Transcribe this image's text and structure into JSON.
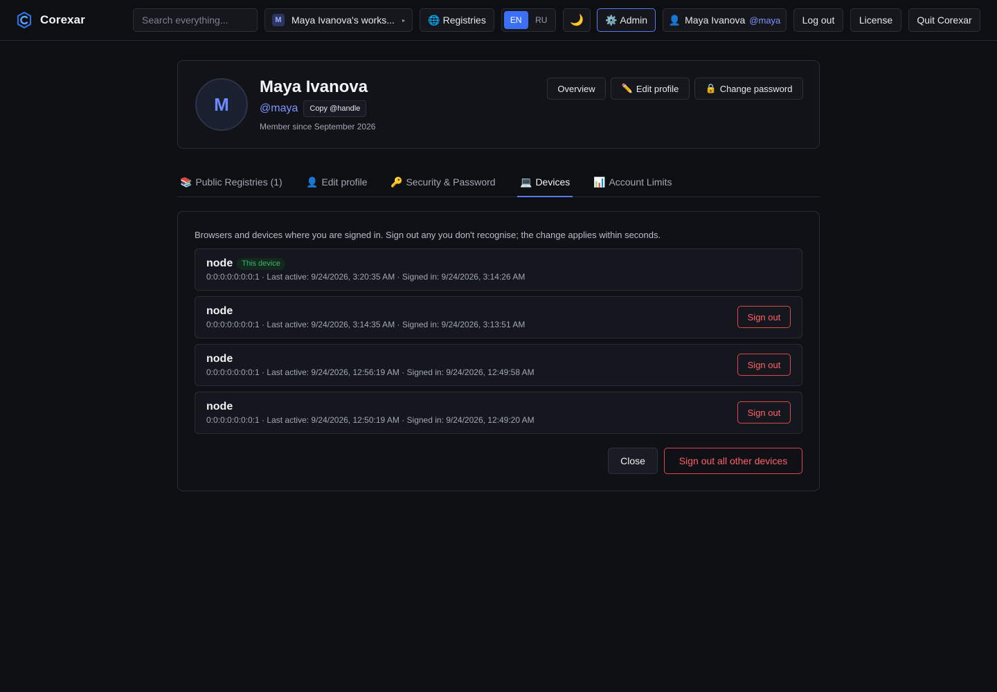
{
  "app": {
    "name": "Corexar",
    "brand_color": "#3b8cf5"
  },
  "topbar": {
    "search_placeholder": "Search everything...",
    "workspace": {
      "badge": "M",
      "label": "Maya Ivanova's works...",
      "caret": "▸"
    },
    "registries_icon": "🌐",
    "registries_label": "Registries",
    "languages": [
      {
        "code": "EN",
        "active": true
      },
      {
        "code": "RU",
        "active": false
      }
    ],
    "theme_icon": "🌙",
    "admin_icon": "⚙️",
    "admin_label": "Admin",
    "user_icon": "👤",
    "user_name": "Maya Ivanova",
    "user_handle": "@maya",
    "logout_label": "Log out",
    "license_label": "License",
    "quit_label": "Quit Corexar"
  },
  "profile": {
    "avatar_letter": "M",
    "name": "Maya Ivanova",
    "handle": "@maya",
    "copy_label": "Copy @handle",
    "member_since": "Member since September 2026",
    "actions": {
      "overview": "Overview",
      "edit_icon": "✏️",
      "edit": "Edit profile",
      "password_icon": "🔒",
      "password": "Change password"
    }
  },
  "tabs": [
    {
      "icon": "📚",
      "label": "Public Registries (1)",
      "active": false
    },
    {
      "icon": "👤",
      "label": "Edit profile",
      "active": false
    },
    {
      "icon": "🔑",
      "label": "Security & Password",
      "active": false
    },
    {
      "icon": "💻",
      "label": "Devices",
      "active": true
    },
    {
      "icon": "📊",
      "label": "Account Limits",
      "active": false
    }
  ],
  "devices": {
    "intro": "Browsers and devices where you are signed in. Sign out any you don't recognise; the change applies within seconds.",
    "this_device_label": "This device",
    "sign_out_label": "Sign out",
    "list": [
      {
        "name": "node",
        "current": true,
        "meta": "0:0:0:0:0:0:0:1 · Last active: 9/24/2026, 3:20:35 AM · Signed in: 9/24/2026, 3:14:26 AM"
      },
      {
        "name": "node",
        "current": false,
        "meta": "0:0:0:0:0:0:0:1 · Last active: 9/24/2026, 3:14:35 AM · Signed in: 9/24/2026, 3:13:51 AM"
      },
      {
        "name": "node",
        "current": false,
        "meta": "0:0:0:0:0:0:0:1 · Last active: 9/24/2026, 12:56:19 AM · Signed in: 9/24/2026, 12:49:58 AM"
      },
      {
        "name": "node",
        "current": false,
        "meta": "0:0:0:0:0:0:0:1 · Last active: 9/24/2026, 12:50:19 AM · Signed in: 9/24/2026, 12:49:20 AM"
      }
    ],
    "close_label": "Close",
    "sign_out_all_label": "Sign out all other devices"
  }
}
